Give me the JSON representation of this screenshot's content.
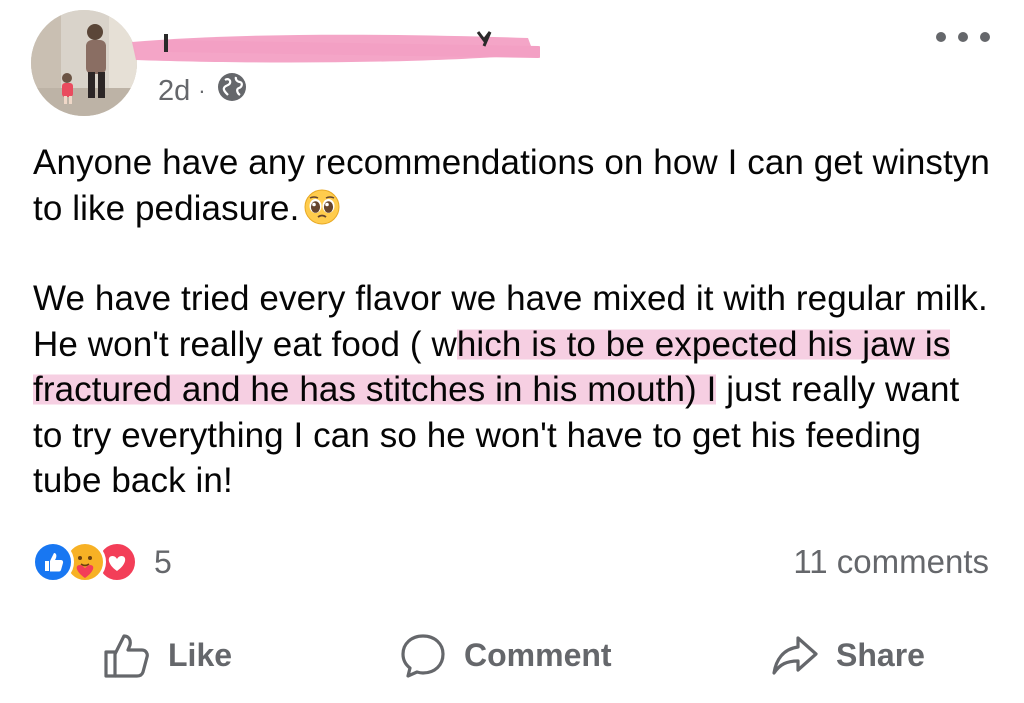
{
  "post": {
    "timestamp": "2d",
    "separator": "·",
    "privacy_icon": "globe-icon",
    "more_icon": "more-options-icon",
    "body": {
      "paragraph1": "Anyone have any recommendations on how I can get winstyn to like pediasure.",
      "paragraph1_emoji": "pleading-face-emoji",
      "paragraph2_part1": "We have tried every flavor we have mixed it with regular milk. He won't really eat food ( w",
      "paragraph2_highlighted": "hich is to be expected his jaw is fractured and he has stitches in his mouth) I",
      "paragraph2_part2": " just really want to try everything I can so he won't have to get his feeding tube back in!",
      "highlight_color": "#f6cfe2"
    },
    "reactions": {
      "icons": [
        "like-reaction-icon",
        "care-reaction-icon",
        "love-reaction-icon"
      ],
      "count": "5"
    },
    "comments_count": "11 comments",
    "actions": {
      "like": "Like",
      "comment": "Comment",
      "share": "Share"
    },
    "redaction_color": "#f3a0c4"
  }
}
